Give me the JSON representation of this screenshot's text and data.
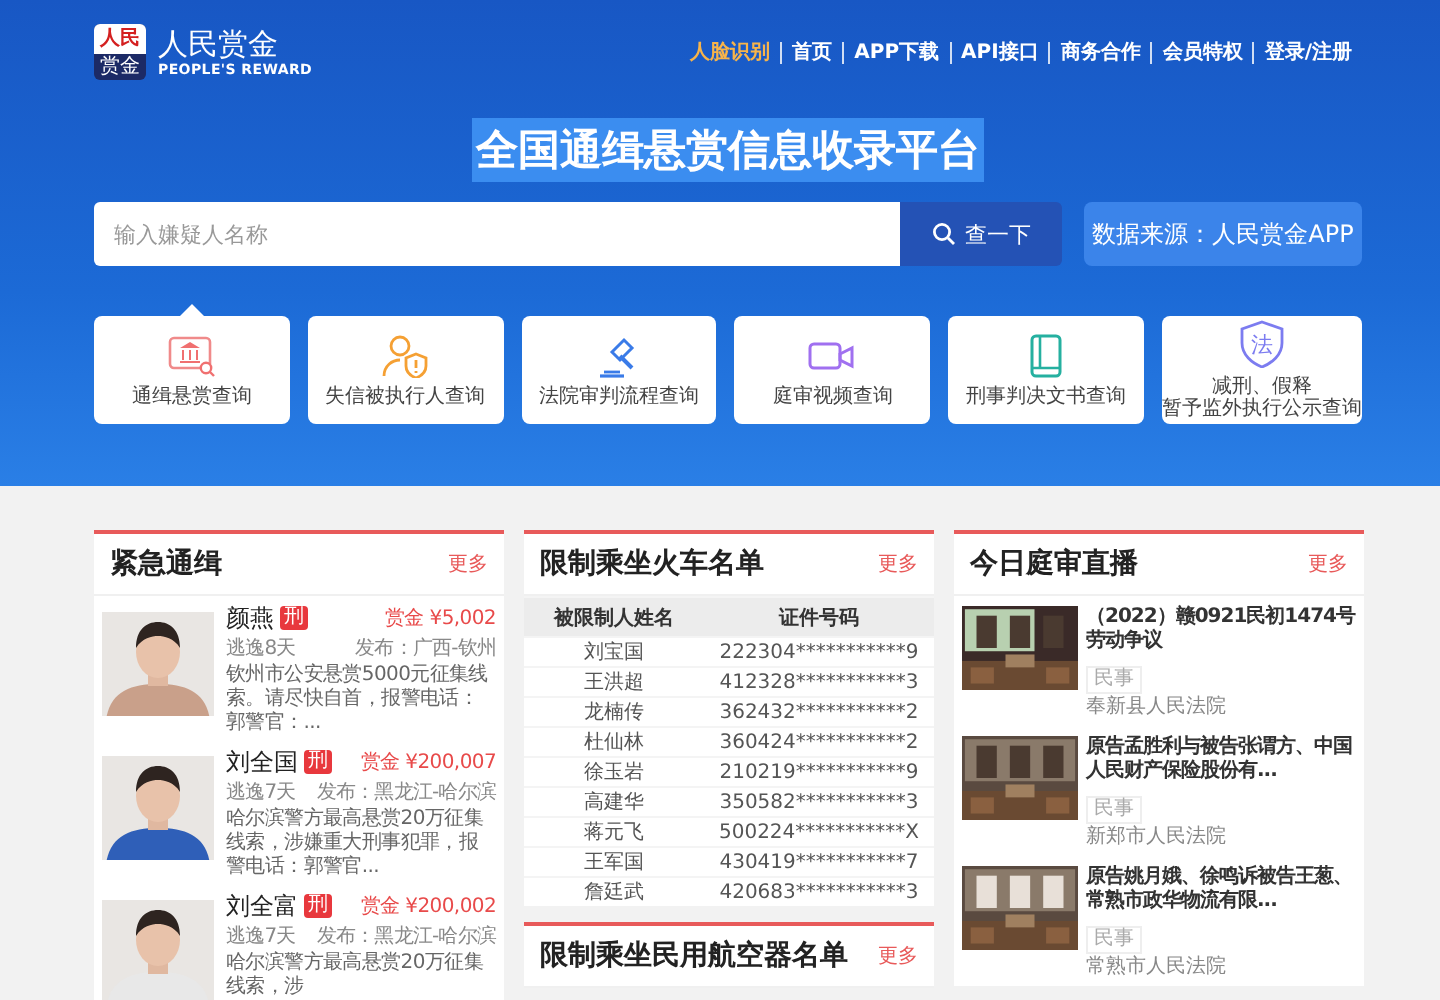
{
  "header": {
    "logo": {
      "mark_top": "人民",
      "mark_bottom": "赏金",
      "name": "人民赏金",
      "subtitle": "PEOPLE'S REWARD"
    },
    "nav": [
      {
        "label": "人脸识别",
        "selected": true
      },
      {
        "label": "首页",
        "selected": false
      },
      {
        "label": "APP下载",
        "selected": false
      },
      {
        "label": "API接口",
        "selected": false
      },
      {
        "label": "商务合作",
        "selected": false
      },
      {
        "label": "会员特权",
        "selected": false
      },
      {
        "label": "登录/注册",
        "selected": false
      }
    ],
    "title": "全国通缉悬赏信息收录平台",
    "search": {
      "placeholder": "输入嫌疑人名称",
      "button": "查一下"
    },
    "source": "数据来源：人民赏金APP",
    "services": [
      {
        "kind": "wanted",
        "lines": [
          "通缉悬赏查询"
        ],
        "selected": true
      },
      {
        "kind": "dishonest",
        "lines": [
          "失信被执行人查询"
        ],
        "selected": false
      },
      {
        "kind": "trial",
        "lines": [
          "法院审判流程查询"
        ],
        "selected": false
      },
      {
        "kind": "video",
        "lines": [
          "庭审视频查询"
        ],
        "selected": false
      },
      {
        "kind": "judgment",
        "lines": [
          "刑事判决文书查询"
        ],
        "selected": false
      },
      {
        "kind": "law",
        "icon_text": "法",
        "lines": [
          "减刑、假释",
          "暂予监外执行公示查询"
        ],
        "selected": false
      }
    ]
  },
  "wanted": {
    "title": "紧急通缉",
    "more": "更多",
    "items": [
      {
        "name": "颜燕",
        "badge": "刑",
        "reward": "赏金 ¥5,002",
        "days": "逃逸8天",
        "publisher": "发布：广西-钦州",
        "desc": "钦州市公安悬赏5000元征集线索。请尽快自首，报警电话：郭警官：..."
      },
      {
        "name": "刘全国",
        "badge": "刑",
        "reward": "赏金 ¥200,007",
        "days": "逃逸7天",
        "publisher": "发布：黑龙江-哈尔滨",
        "desc": "哈尔滨警方最高悬赏20万征集线索，涉嫌重大刑事犯罪，报警电话：郭警官..."
      },
      {
        "name": "刘全富",
        "badge": "刑",
        "reward": "赏金 ¥200,002",
        "days": "逃逸7天",
        "publisher": "发布：黑龙江-哈尔滨",
        "desc": "哈尔滨警方最高悬赏20万征集线索，涉"
      }
    ]
  },
  "train": {
    "title": "限制乘坐火车名单",
    "more": "更多",
    "columns": [
      "被限制人姓名",
      "证件号码"
    ],
    "rows": [
      [
        "刘宝国",
        "222304***********9"
      ],
      [
        "王洪超",
        "412328***********3"
      ],
      [
        "龙楠传",
        "362432***********2"
      ],
      [
        "杜仙林",
        "360424***********2"
      ],
      [
        "徐玉岩",
        "210219***********9"
      ],
      [
        "高建华",
        "350582***********3"
      ],
      [
        "蒋元飞",
        "500224***********X"
      ],
      [
        "王军国",
        "430419***********7"
      ],
      [
        "詹廷武",
        "420683***********3"
      ]
    ]
  },
  "flight": {
    "title": "限制乘坐民用航空器名单",
    "more": "更多"
  },
  "live": {
    "title": "今日庭审直播",
    "more": "更多",
    "items": [
      {
        "title": "（2022）赣0921民初1474号劳动争议",
        "tag": "民事",
        "court": "奉新县人民法院"
      },
      {
        "title": "原告孟胜利与被告张谓方、中国人民财产保险股份有...",
        "tag": "民事",
        "court": "新郑市人民法院"
      },
      {
        "title": "原告姚月娥、徐鸣诉被告王葱、常熟市政华物流有限...",
        "tag": "民事",
        "court": "常熟市人民法院"
      }
    ]
  }
}
